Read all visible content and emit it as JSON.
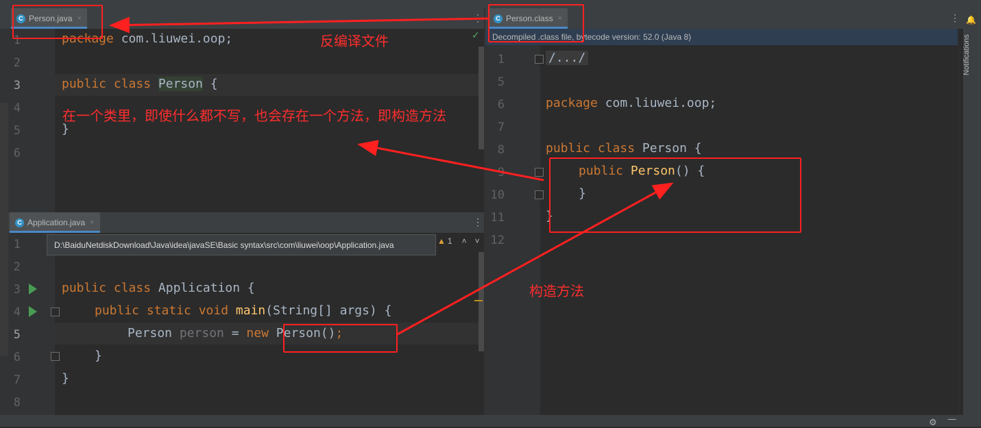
{
  "left_top_pane": {
    "tab_label": "Person.java",
    "tab_close": "×",
    "menu": "⋮",
    "check": "✓",
    "line_numbers": [
      "1",
      "2",
      "3",
      "4",
      "5",
      "6"
    ],
    "code": {
      "line1_kw": "package",
      "line1_rest": " com.liuwei.oop;",
      "line3_kw": "public class ",
      "line3_cls": "Person",
      "line3_rest": " {",
      "line5": "}"
    }
  },
  "left_bottom_pane": {
    "tab_label": "Application.java",
    "tab_close": "×",
    "menu": "⋮",
    "path_tooltip": "D:\\BaiduNetdiskDownload\\Java\\idea\\javaSE\\Basic syntax\\src\\com\\liuwei\\oop\\Application.java",
    "warning_count": "1",
    "nav_up": "˄",
    "nav_down": "˅",
    "line_numbers": [
      "1",
      "2",
      "3",
      "4",
      "5",
      "6",
      "7",
      "8"
    ],
    "code": {
      "line3_kw": "public class ",
      "line3_rest": "Application {",
      "line4_kw": "public static void ",
      "line4_fn": "main",
      "line4_rest": "(String[] args) {",
      "line5_type": "Person ",
      "line5_var": "person",
      "line5_eq": " = ",
      "line5_new": "new ",
      "line5_call": "Person()",
      "line5_semi": ";",
      "line6": "}",
      "line7": "}"
    }
  },
  "right_pane": {
    "tab_label": "Person.class",
    "tab_close": "×",
    "menu": "⋮",
    "banner": "Decompiled .class file, bytecode version: 52.0 (Java 8)",
    "line_numbers": [
      "1",
      "5",
      "6",
      "7",
      "8",
      "9",
      "10",
      "11",
      "12"
    ],
    "code": {
      "line1": "/.../",
      "line6_kw": "package",
      "line6_rest": " com.liuwei.oop;",
      "line8_kw": "public class ",
      "line8_rest": "Person {",
      "line9_kw": "public ",
      "line9_fn": "Person",
      "line9_rest": "() {",
      "line10": "}",
      "line11": "}"
    }
  },
  "side_strip": {
    "label": "Notifications"
  },
  "annotations": {
    "decompile_label": "反编译文件",
    "default_constructor_note": "在一个类里，即使什么都不写，也会存在一个方法，即构造方法",
    "constructor_label": "构造方法"
  },
  "colors": {
    "editor_bg": "#2b2b2b",
    "keyword": "#cc7832",
    "function": "#ffc66d",
    "annotation_red": "#ff2020"
  }
}
